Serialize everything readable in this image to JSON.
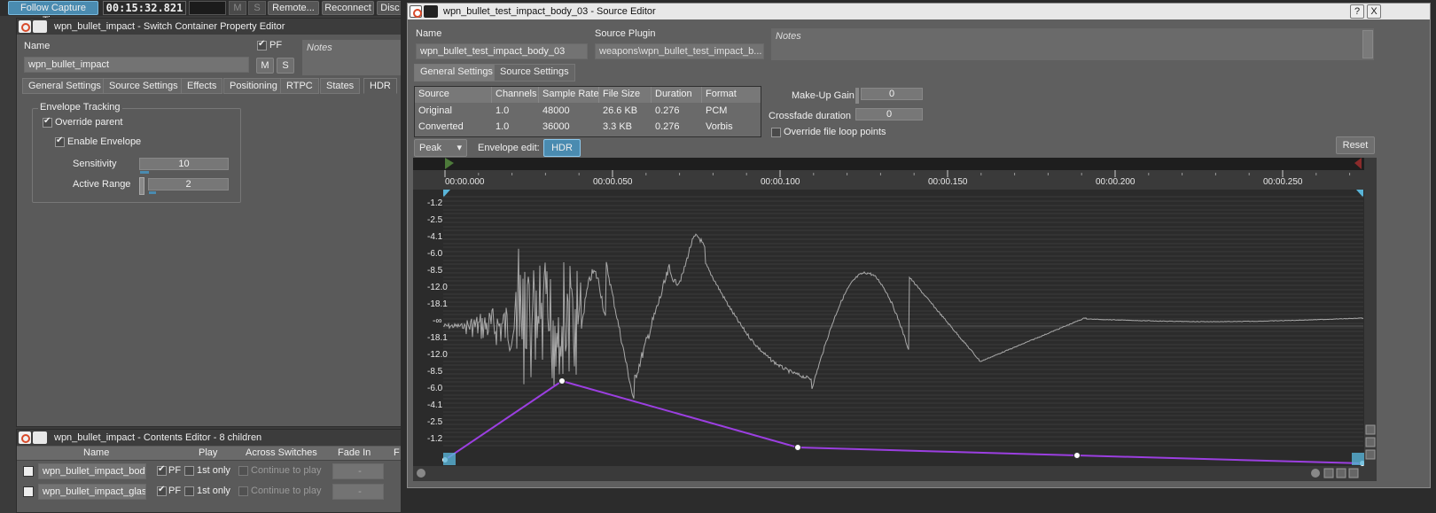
{
  "toolbar": {
    "follow_label": "Follow Capture Time",
    "time": "00:15:32.821",
    "m_label": "M",
    "s_label": "S",
    "remote_label": "Remote...",
    "reconnect_label": "Reconnect",
    "disc_label": "Disc"
  },
  "property_editor": {
    "title": "wpn_bullet_impact - Switch Container Property Editor",
    "name_label": "Name",
    "name_value": "wpn_bullet_impact",
    "pf_label": "PF",
    "m_label": "M",
    "s_label": "S",
    "notes_label": "Notes",
    "tabs": [
      "General Settings",
      "Source Settings",
      "Effects",
      "Positioning",
      "RTPC",
      "States",
      "HDR"
    ],
    "active_tab": "HDR",
    "envelope_group_label": "Envelope Tracking",
    "override_parent_label": "Override parent",
    "enable_envelope_label": "Enable Envelope",
    "sensitivity_label": "Sensitivity",
    "sensitivity_value": "10",
    "active_range_label": "Active Range",
    "active_range_value": "2"
  },
  "contents_editor": {
    "title": "wpn_bullet_impact - Contents Editor - 8 children",
    "columns": [
      "Name",
      "Play",
      "Across Switches",
      "Fade In",
      "F"
    ],
    "rows": [
      {
        "name": "wpn_bullet_impact_body",
        "pf": "PF",
        "play": "1st only",
        "across": "Continue to play",
        "fade_in": "-"
      },
      {
        "name": "wpn_bullet_impact_glass",
        "pf": "PF",
        "play": "1st only",
        "across": "Continue to play",
        "fade_in": "-"
      }
    ]
  },
  "source_editor": {
    "title": "wpn_bullet_test_impact_body_03 - Source Editor",
    "help_label": "?",
    "close_label": "X",
    "name_label": "Name",
    "name_value": "wpn_bullet_test_impact_body_03",
    "plugin_label": "Source Plugin",
    "plugin_value": "weapons\\wpn_bullet_test_impact_b...",
    "notes_label": "Notes",
    "tabs": [
      "General Settings",
      "Source Settings"
    ],
    "active_tab": "General Settings",
    "table": {
      "columns": [
        "Source",
        "Channels",
        "Sample Rate",
        "File Size",
        "Duration",
        "Format"
      ],
      "rows": [
        [
          "Original",
          "1.0",
          "48000",
          "26.6 KB",
          "0.276",
          "PCM"
        ],
        [
          "Converted",
          "1.0",
          "36000",
          "3.3 KB",
          "0.276",
          "Vorbis"
        ]
      ]
    },
    "makeup_gain_label": "Make-Up Gain",
    "makeup_gain_value": "0",
    "crossfade_label": "Crossfade duration",
    "crossfade_value": "0",
    "override_loop_label": "Override file loop points",
    "peak_label": "Peak",
    "envelope_edit_label": "Envelope edit:",
    "hdr_button_label": "HDR",
    "reset_label": "Reset",
    "timeline_ticks": [
      "00:00.000",
      "00:00.050",
      "00:00.100",
      "00:00.150",
      "00:00.200",
      "00:00.250"
    ],
    "db_labels_top": [
      "-1.2",
      "-2.5",
      "-4.1",
      "-6.0",
      "-8.5",
      "-12.0",
      "-18.1",
      "-∞"
    ],
    "db_labels_bottom": [
      "-18.1",
      "-12.0",
      "-8.5",
      "-6.0",
      "-4.1",
      "-2.5",
      "-1.2"
    ],
    "envelope_color": "#9b3fe0",
    "accent_color": "#4a8bb0"
  }
}
